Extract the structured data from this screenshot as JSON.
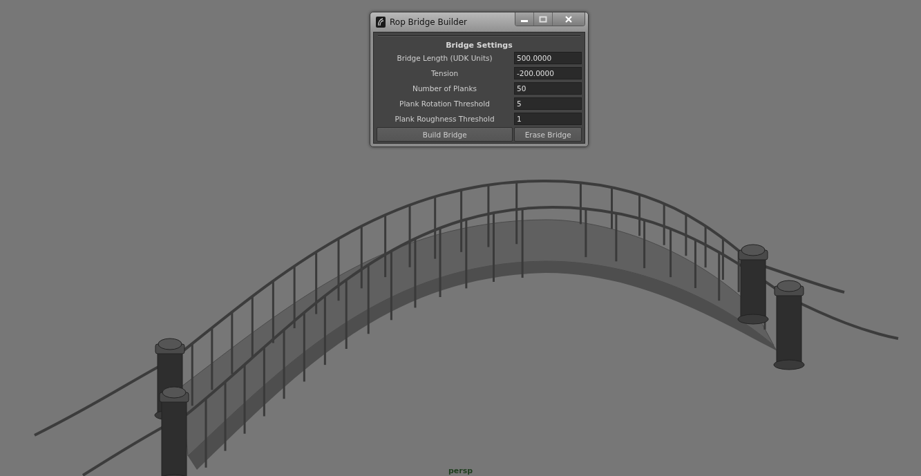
{
  "window": {
    "title": "Rop Bridge Builder"
  },
  "section": {
    "title": "Bridge Settings"
  },
  "fields": [
    {
      "label": "Bridge Length (UDK Units)",
      "value": "500.0000"
    },
    {
      "label": "Tension",
      "value": "-200.0000"
    },
    {
      "label": "Number of Planks",
      "value": "50"
    },
    {
      "label": "Plank Rotation Threshold",
      "value": "5"
    },
    {
      "label": "Plank Roughness Threshold",
      "value": "1"
    }
  ],
  "buttons": [
    "Build Bridge",
    "Erase Bridge"
  ],
  "viewport": {
    "camera_label": "persp"
  }
}
